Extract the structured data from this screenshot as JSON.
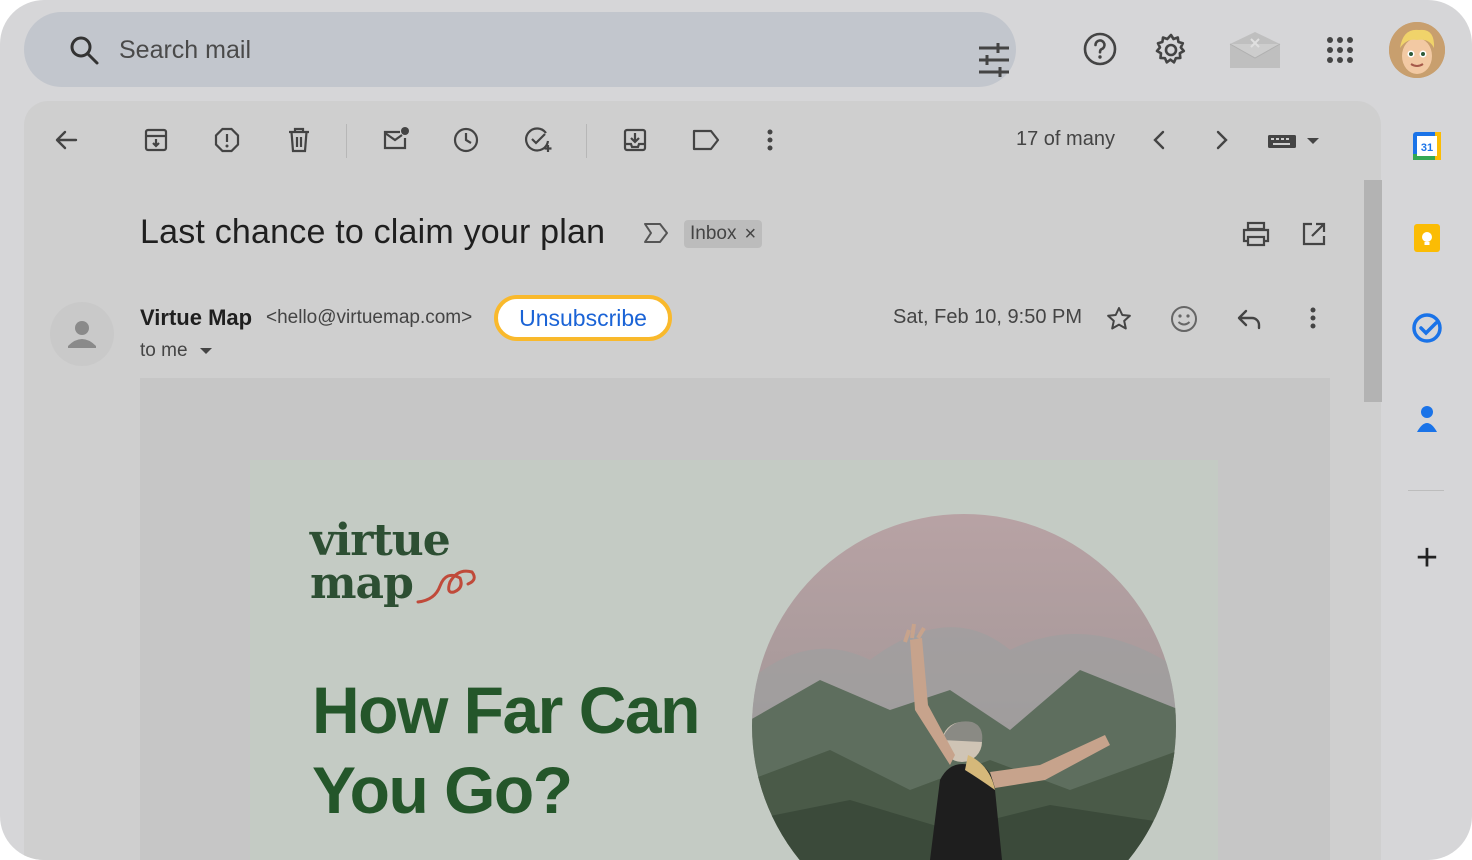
{
  "search": {
    "placeholder": "Search mail"
  },
  "toolbar": {
    "count": "17 of many"
  },
  "email": {
    "subject": "Last chance to claim your plan",
    "label_chip": "Inbox",
    "label_remove": "×",
    "sender_name": "Virtue Map",
    "sender_email": "<hello@virtuemap.com>",
    "unsubscribe": "Unsubscribe",
    "to": "to me",
    "date": "Sat, Feb 10, 9:50 PM"
  },
  "content": {
    "brand_line1": "virtue",
    "brand_line2": "map",
    "headline_line1": "How Far Can",
    "headline_line2": "You Go?"
  },
  "side_panel": {
    "calendar_day": "31",
    "add": "+"
  },
  "colors": {
    "accent_highlight": "#f9b92c",
    "link_blue": "#1a63d6",
    "brand_green": "#24562a",
    "calendar_blue": "#1a73e8",
    "keep_yellow": "#fbbc04"
  },
  "icons": [
    "search-icon",
    "tune-icon",
    "help-icon",
    "gear-icon",
    "mail-icon",
    "apps-icon",
    "back-icon",
    "archive-icon",
    "report-spam-icon",
    "delete-icon",
    "mark-unread-icon",
    "snooze-icon",
    "add-task-icon",
    "move-to-icon",
    "label-icon",
    "more-icon",
    "prev-icon",
    "next-icon",
    "keyboard-icon",
    "print-icon",
    "open-new-window-icon",
    "star-icon",
    "emoji-icon",
    "reply-icon",
    "calendar-icon",
    "keep-icon",
    "tasks-icon",
    "contacts-icon"
  ]
}
